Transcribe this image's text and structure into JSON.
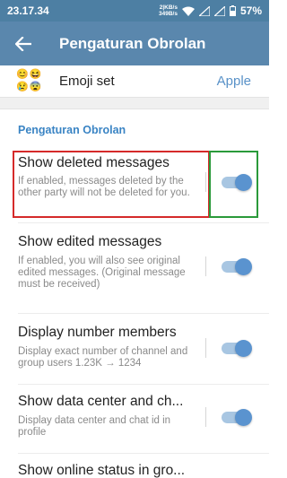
{
  "status_bar": {
    "time": "23.17.34",
    "net_speed_up": "2|KB/s",
    "net_speed_down": "349B/s",
    "battery": "57%"
  },
  "toolbar": {
    "title": "Pengaturan Obrolan",
    "back_icon": "arrow-back-icon"
  },
  "emoji_set": {
    "label": "Emoji set",
    "value": "Apple",
    "faces": [
      "😊",
      "😆",
      "😢",
      "😨"
    ]
  },
  "section": {
    "header": "Pengaturan Obrolan"
  },
  "settings": [
    {
      "title": "Show deleted messages",
      "description": "If enabled, messages deleted by the other party will not be deleted for you.",
      "enabled": true
    },
    {
      "title": "Show edited messages",
      "description": "If enabled, you will also see original edited messages. (Original message must be received)",
      "enabled": true
    },
    {
      "title": "Display number members",
      "description": "Display exact number of channel and group users 1.23K → 1234",
      "enabled": true
    },
    {
      "title": "Show data center and ch...",
      "description": "Display data center and chat id in profile",
      "enabled": true
    },
    {
      "title": "Show online status in gro...",
      "description": "",
      "enabled": true
    }
  ],
  "colors": {
    "toolbar": "#5a87ad",
    "status_bar": "#4d7fa3",
    "accent": "#3a84c4",
    "toggle_on": "#5a93cf",
    "highlight_red": "#d52a2a",
    "highlight_green": "#2a9a3a"
  }
}
